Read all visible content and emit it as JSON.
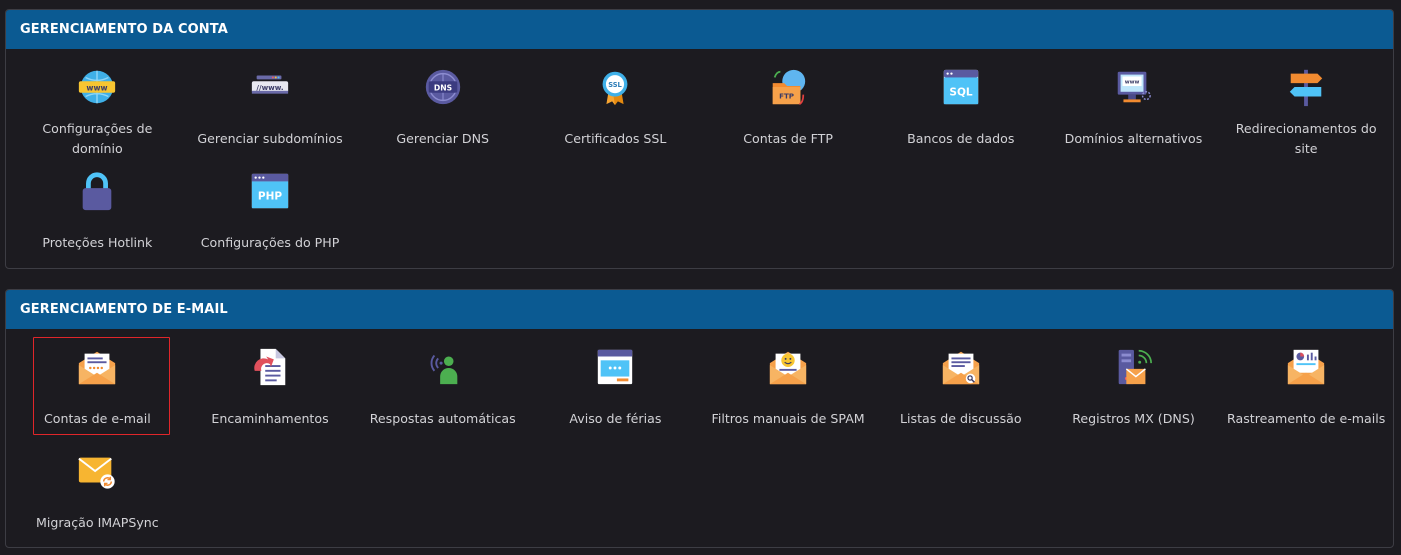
{
  "account": {
    "title": "GERENCIAMENTO DA CONTA",
    "items": [
      {
        "label": "Configurações de domínio",
        "icon": "www-globe-icon"
      },
      {
        "label": "Gerenciar subdomínios",
        "icon": "subdomain-browser-icon"
      },
      {
        "label": "Gerenciar DNS",
        "icon": "dns-globe-icon"
      },
      {
        "label": "Certificados SSL",
        "icon": "ssl-badge-icon"
      },
      {
        "label": "Contas de FTP",
        "icon": "ftp-folder-icon"
      },
      {
        "label": "Bancos de dados",
        "icon": "sql-database-icon"
      },
      {
        "label": "Domínios alternativos",
        "icon": "domain-monitor-icon"
      },
      {
        "label": "Redirecionamentos do site",
        "icon": "signpost-icon"
      },
      {
        "label": "Proteções Hotlink",
        "icon": "padlock-icon"
      },
      {
        "label": "Configurações do PHP",
        "icon": "php-window-icon"
      }
    ]
  },
  "email": {
    "title": "GERENCIAMENTO DE E-MAIL",
    "items": [
      {
        "label": "Contas de e-mail",
        "icon": "email-account-icon",
        "selected": true
      },
      {
        "label": "Encaminhamentos",
        "icon": "forward-document-icon"
      },
      {
        "label": "Respostas automáticas",
        "icon": "autoresponder-person-icon"
      },
      {
        "label": "Aviso de férias",
        "icon": "vacation-message-icon"
      },
      {
        "label": "Filtros manuais de SPAM",
        "icon": "spam-filter-envelope-icon"
      },
      {
        "label": "Listas de discussão",
        "icon": "mailing-list-envelope-icon"
      },
      {
        "label": "Registros MX (DNS)",
        "icon": "mx-server-icon"
      },
      {
        "label": "Rastreamento de e-mails",
        "icon": "email-tracking-icon"
      },
      {
        "label": "Migração IMAPSync",
        "icon": "imap-sync-envelope-icon"
      }
    ]
  },
  "colors": {
    "header_bg": "#0b5a92",
    "page_bg": "#1c1b20",
    "selection_border": "#e0262a"
  }
}
